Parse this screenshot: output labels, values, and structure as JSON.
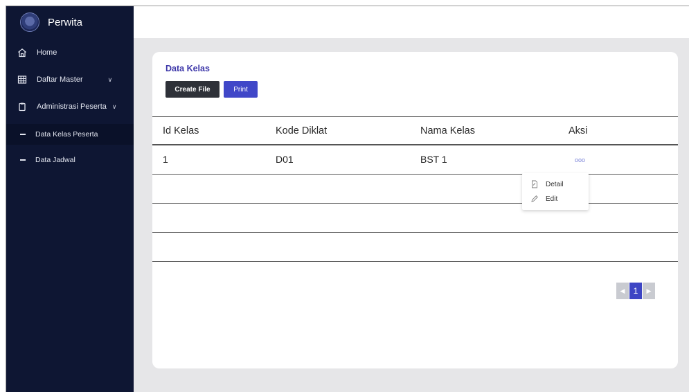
{
  "brand": {
    "name": "Perwita"
  },
  "sidebar": {
    "items": [
      {
        "label": "Home",
        "icon": "home-icon"
      },
      {
        "label": "Daftar Master",
        "icon": "grid-icon",
        "expandable": true
      },
      {
        "label": "Administrasi Peserta",
        "icon": "clipboard-icon",
        "expandable": true
      }
    ],
    "sub_items": [
      {
        "label": "Data Kelas Peserta",
        "active": true
      },
      {
        "label": "Data Jadwal",
        "active": false
      }
    ]
  },
  "card": {
    "title": "Data Kelas",
    "create_label": "Create File",
    "print_label": "Print"
  },
  "table": {
    "headers": [
      "Id Kelas",
      "Kode Diklat",
      "Nama Kelas",
      "Aksi"
    ],
    "rows": [
      [
        "1",
        "D01",
        "BST 1",
        "ooo"
      ]
    ]
  },
  "action_menu": {
    "detail_label": "Detail",
    "edit_label": "Edit"
  },
  "pagination": {
    "current": "1",
    "prev": "◀",
    "next": "▶"
  },
  "colors": {
    "sidebar_bg": "#0e1633",
    "accent": "#3d45c4",
    "title": "#3b35a8",
    "dark_button": "#2e3138"
  }
}
